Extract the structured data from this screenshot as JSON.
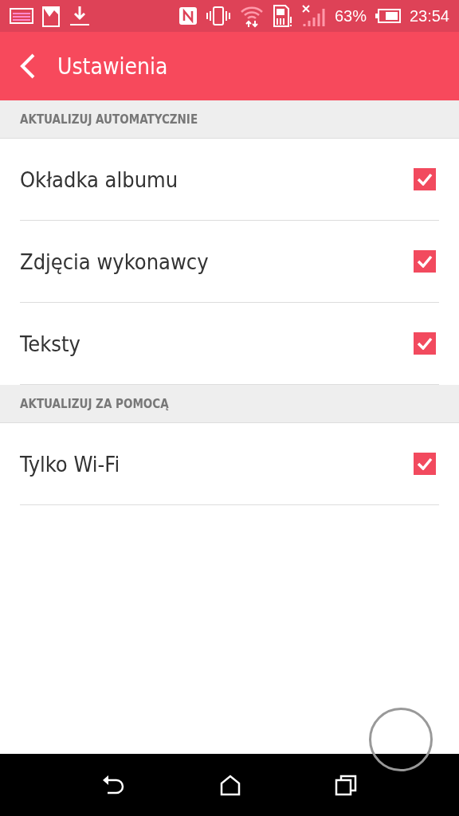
{
  "status_bar": {
    "battery": "63%",
    "time": "23:54"
  },
  "app_bar": {
    "title": "Ustawienia"
  },
  "sections": [
    {
      "header": "AKTUALIZUJ AUTOMATYCZNIE",
      "items": [
        {
          "label": "Okładka albumu",
          "checked": true
        },
        {
          "label": "Zdjęcia wykonawcy",
          "checked": true
        },
        {
          "label": "Teksty",
          "checked": true
        }
      ]
    },
    {
      "header": "AKTUALIZUJ ZA POMOCĄ",
      "items": [
        {
          "label": "Tylko Wi-Fi",
          "checked": true
        }
      ]
    }
  ]
}
